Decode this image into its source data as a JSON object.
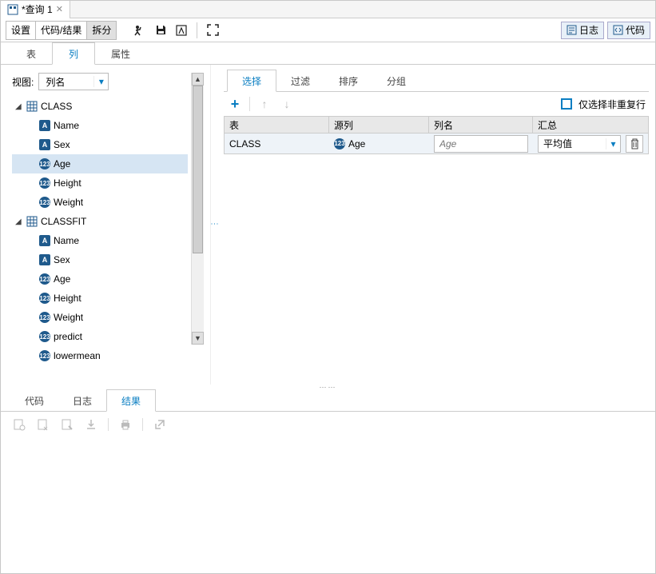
{
  "tab": {
    "title": "*查询 1"
  },
  "toolbar": {
    "settings": "设置",
    "codeResult": "代码/结果",
    "split": "拆分",
    "log": "日志",
    "code": "代码"
  },
  "mainTabs": {
    "tables": "表",
    "columns": "列",
    "properties": "属性"
  },
  "leftPanel": {
    "viewLabel": "视图:",
    "viewValue": "列名",
    "tree": [
      {
        "kind": "table",
        "label": "CLASS"
      },
      {
        "kind": "leaf",
        "type": "A",
        "label": "Name"
      },
      {
        "kind": "leaf",
        "type": "A",
        "label": "Sex"
      },
      {
        "kind": "leaf",
        "type": "N",
        "label": "Age",
        "selected": true
      },
      {
        "kind": "leaf",
        "type": "N",
        "label": "Height"
      },
      {
        "kind": "leaf",
        "type": "N",
        "label": "Weight"
      },
      {
        "kind": "table",
        "label": "CLASSFIT"
      },
      {
        "kind": "leaf",
        "type": "A",
        "label": "Name"
      },
      {
        "kind": "leaf",
        "type": "A",
        "label": "Sex"
      },
      {
        "kind": "leaf",
        "type": "N",
        "label": "Age"
      },
      {
        "kind": "leaf",
        "type": "N",
        "label": "Height"
      },
      {
        "kind": "leaf",
        "type": "N",
        "label": "Weight"
      },
      {
        "kind": "leaf",
        "type": "N",
        "label": "predict"
      },
      {
        "kind": "leaf",
        "type": "N",
        "label": "lowermean"
      }
    ]
  },
  "rightPanel": {
    "tabs": {
      "select": "选择",
      "filter": "过滤",
      "sort": "排序",
      "group": "分组"
    },
    "distinctLabel": "仅选择非重复行",
    "headers": {
      "table": "表",
      "sourceCol": "源列",
      "colName": "列名",
      "agg": "汇总"
    },
    "row": {
      "table": "CLASS",
      "sourceCol": "Age",
      "colNamePlaceholder": "Age",
      "aggValue": "平均值"
    }
  },
  "bottomTabs": {
    "code": "代码",
    "log": "日志",
    "result": "结果"
  },
  "typeNumBadge": "123"
}
